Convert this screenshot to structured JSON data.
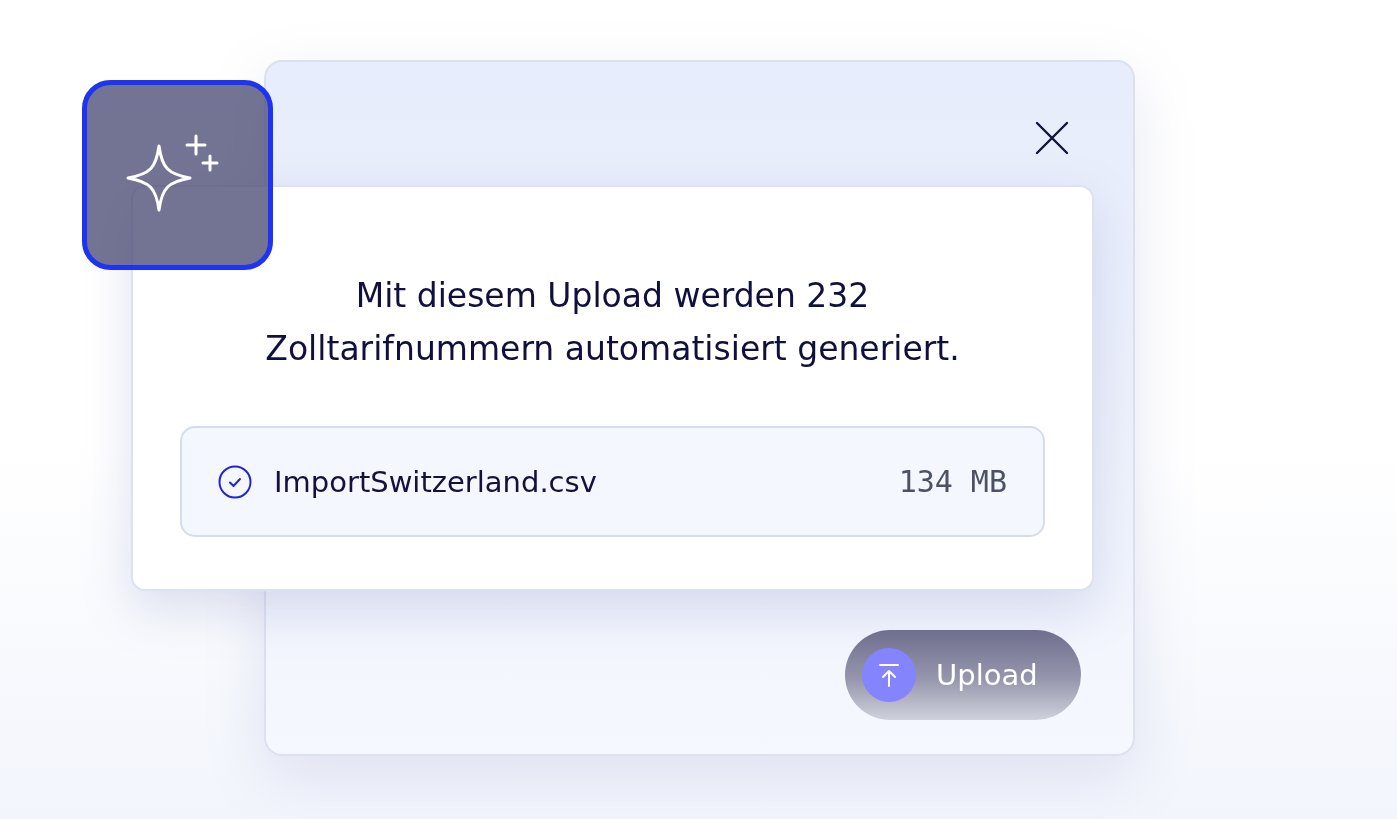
{
  "dialog": {
    "message": "Mit diesem Upload werden 232 Zolltarifnummern automatisiert generiert.",
    "file": {
      "name": "ImportSwitzerland.csv",
      "size": "134 MB",
      "checked": true
    },
    "upload_button": {
      "label": "Upload"
    }
  }
}
